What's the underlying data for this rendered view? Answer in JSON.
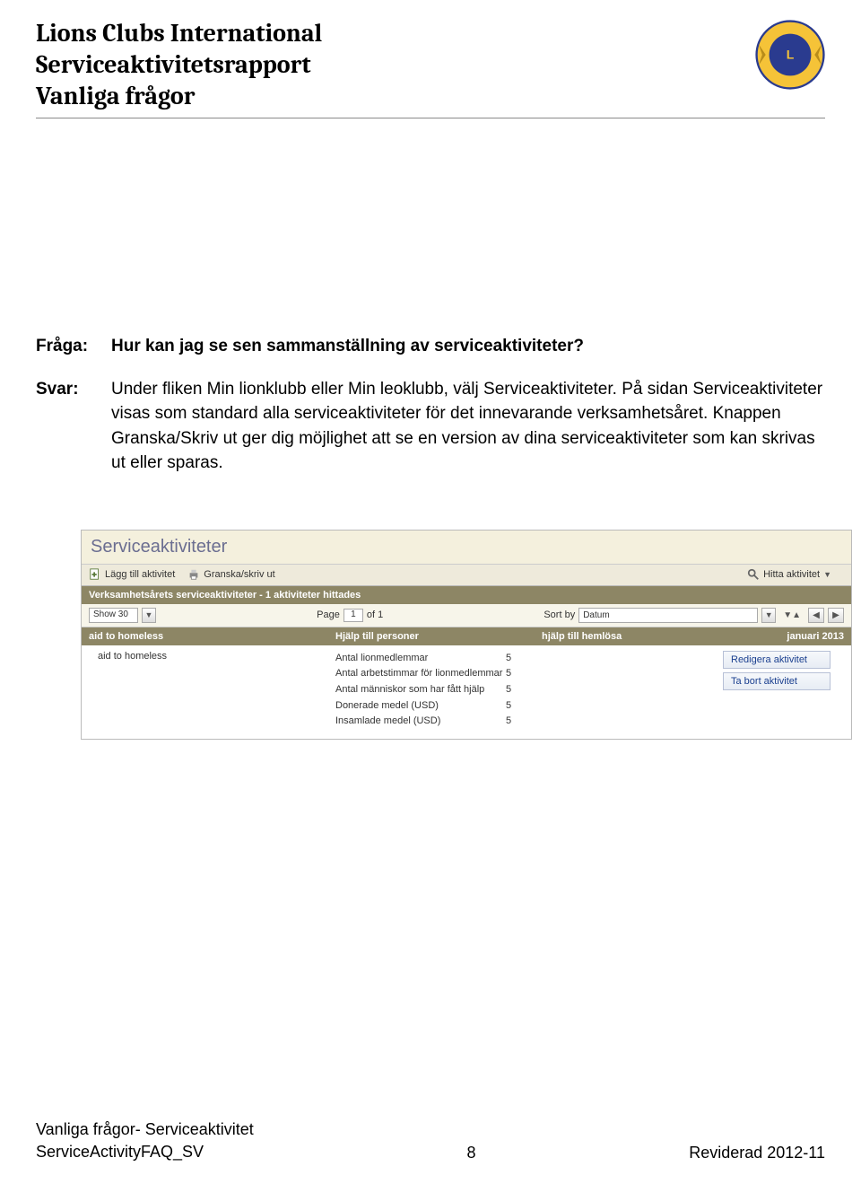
{
  "header": {
    "line1": "Lions Clubs International",
    "line2": "Serviceaktivitetsrapport",
    "line3": "Vanliga frågor"
  },
  "qa": {
    "question_label": "Fråga:",
    "answer_label": "Svar:",
    "question": "Hur kan jag se sen sammanställning av serviceaktiviteter?",
    "answer": "Under fliken Min lionklubb eller Min leoklubb, välj Serviceaktiviteter. På sidan Serviceaktiviteter visas som standard alla serviceaktiviteter för det innevarande verksamhetsåret. Knappen Granska/Skriv ut ger dig möjlighet att se en version av dina serviceaktiviteter som kan skrivas ut eller sparas."
  },
  "embed": {
    "title": "Serviceaktiviteter",
    "toolbar": {
      "add": "Lägg till aktivitet",
      "print": "Granska/skriv ut",
      "find": "Hitta aktivitet"
    },
    "subheader": "Verksamhetsårets serviceaktiviteter - 1 aktiviteter hittades",
    "controls": {
      "show": "Show 30",
      "page_label": "Page",
      "page_value": "1",
      "of": "of 1",
      "sortby": "Sort by",
      "sort_value": "Datum"
    },
    "cols": {
      "c1": "aid to homeless",
      "c2": "Hjälp till personer",
      "c3": "hjälp till hemlösa",
      "c4": "januari 2013"
    },
    "row": {
      "name": "aid to homeless",
      "stats": [
        {
          "label": "Antal lionmedlemmar",
          "value": "5"
        },
        {
          "label": "Antal arbetstimmar för lionmedlemmar",
          "value": "5"
        },
        {
          "label": "Antal människor som har fått hjälp",
          "value": "5"
        },
        {
          "label": "Donerade medel (USD)",
          "value": "5"
        },
        {
          "label": "Insamlade medel (USD)",
          "value": "5"
        }
      ],
      "actions": {
        "edit": "Redigera aktivitet",
        "delete": "Ta bort aktivitet"
      }
    }
  },
  "footer": {
    "left1": "Vanliga frågor- Serviceaktivitet",
    "left2": "ServiceActivityFAQ_SV",
    "center": "8",
    "right": "Reviderad 2012-11"
  }
}
